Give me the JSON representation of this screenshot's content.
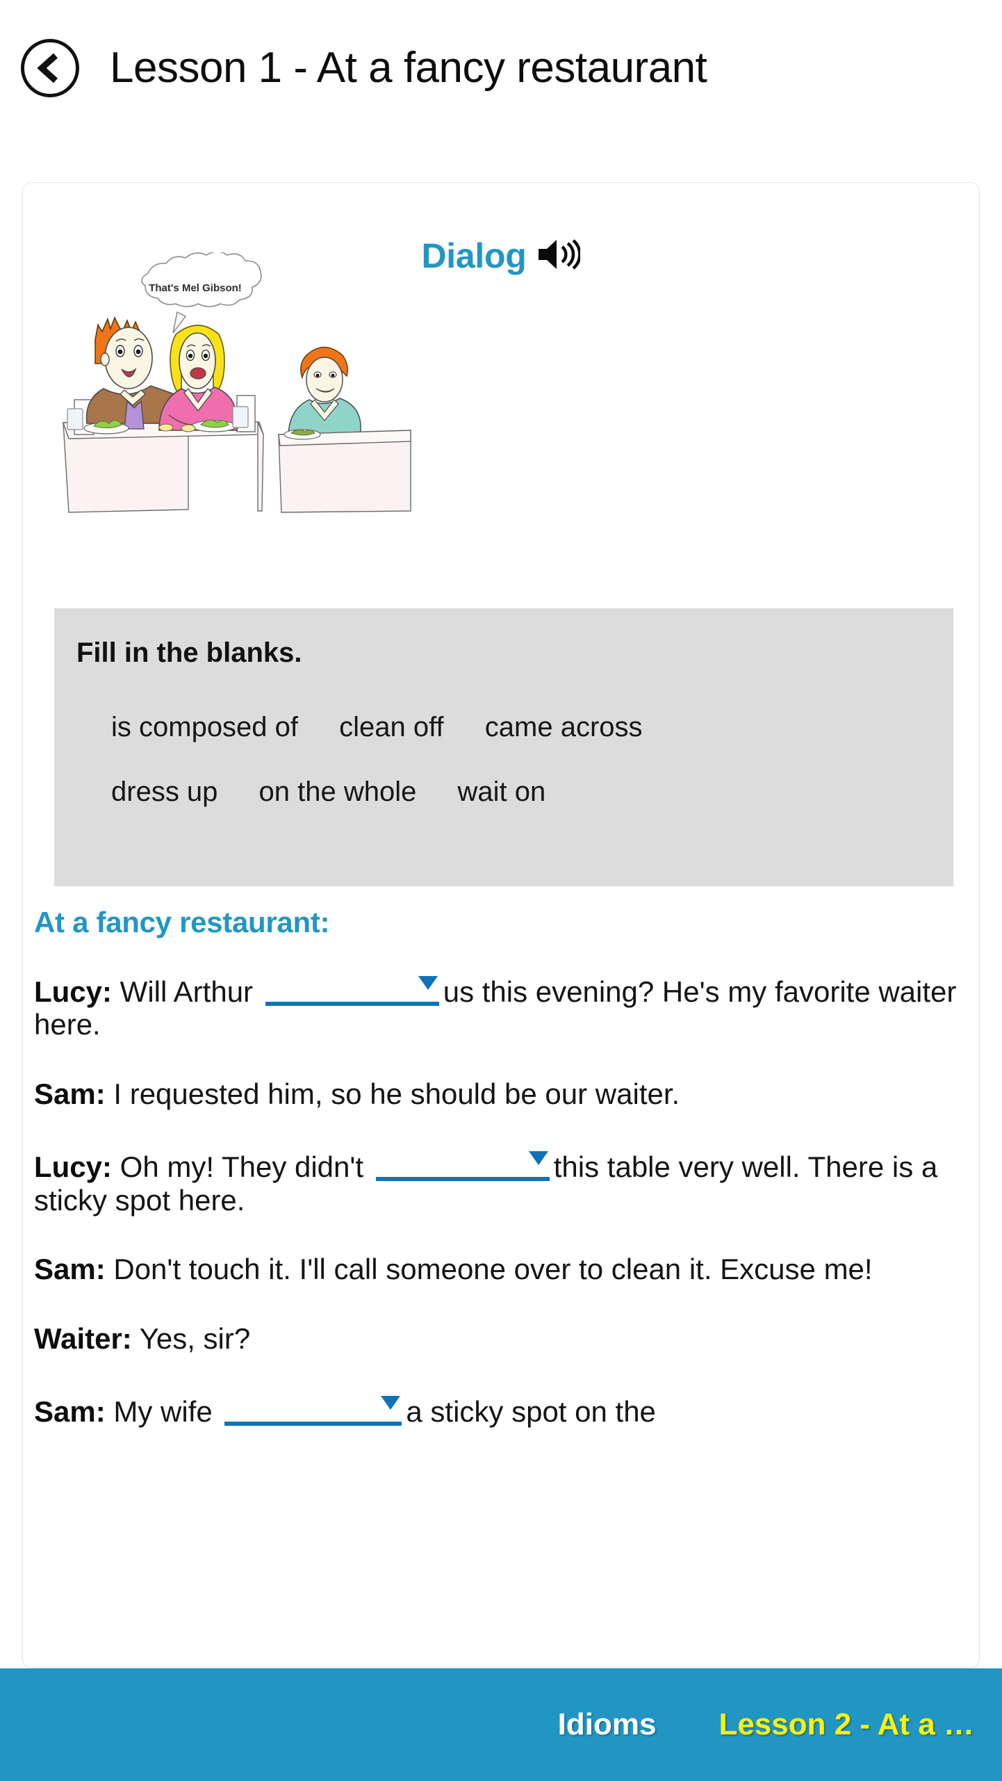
{
  "header": {
    "back_icon": "chevron-left-icon",
    "title": "Lesson 1 - At a fancy restaurant"
  },
  "card": {
    "dialog": {
      "label": "Dialog",
      "audio_icon": "speaker-volume-icon"
    },
    "cartoon": {
      "speech_bubble": "That's Mel Gibson!",
      "alt": "Two diners at a restaurant table and a man seated at another table"
    },
    "wordbank": {
      "title": "Fill in the blanks.",
      "rows": [
        [
          "is composed of",
          "clean off",
          "came across"
        ],
        [
          "dress up",
          "on the whole",
          "wait on"
        ]
      ]
    },
    "section_title": "At a fancy restaurant:",
    "lines": [
      {
        "speaker": "Lucy:",
        "before": " Will Arthur",
        "blank": true,
        "blank_value": "",
        "after": "us this evening? He's my favorite waiter here."
      },
      {
        "speaker": "Sam:",
        "before": " I requested him, so he should be our waiter.",
        "blank": false,
        "blank_value": "",
        "after": ""
      },
      {
        "speaker": "Lucy:",
        "before": " Oh my! They didn't",
        "blank": true,
        "blank_value": "",
        "after": "this table very well. There is a sticky spot here."
      },
      {
        "speaker": "Sam:",
        "before": " Don't touch it. I'll call someone over to clean it. Excuse me!",
        "blank": false,
        "blank_value": "",
        "after": ""
      },
      {
        "speaker": "Waiter:",
        "before": " Yes, sir?",
        "blank": false,
        "blank_value": "",
        "after": ""
      },
      {
        "speaker": "Sam:",
        "before": " My wife",
        "blank": true,
        "blank_value": "",
        "after": "a sticky spot on the"
      }
    ]
  },
  "bottom_bar": {
    "idioms_label": "Idioms",
    "next_lesson_label": "Lesson 2 - At a …"
  },
  "colors": {
    "accent_blue": "#2196c4",
    "bar_blue": "#2196c3",
    "dropdown_blue": "#1073b8",
    "wordbank_gray": "#dcdcdc",
    "next_yellow": "#fbf209"
  }
}
